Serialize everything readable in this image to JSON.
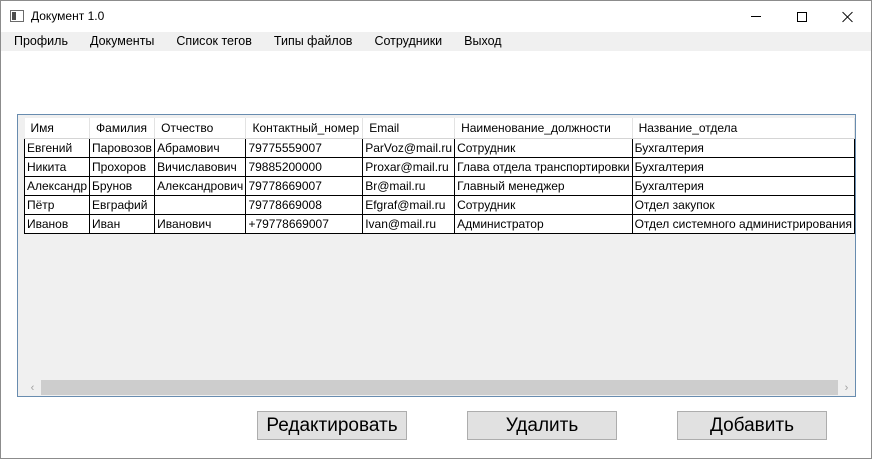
{
  "window": {
    "title": "Документ 1.0"
  },
  "menu": {
    "items": [
      "Профиль",
      "Документы",
      "Список тегов",
      "Типы файлов",
      "Сотрудники",
      "Выход"
    ]
  },
  "grid": {
    "columns": [
      "Имя",
      "Фамилия",
      "Отчество",
      "Контактный_номер",
      "Email",
      "Наименование_должности",
      "Название_отдела"
    ],
    "rows": [
      [
        "Евгений",
        "Паровозов",
        "Абрамович",
        "79775559007",
        "ParVoz@mail.ru",
        "Сотрудник",
        "Бухгалтерия"
      ],
      [
        "Никита",
        "Прохоров",
        "Вичиславович",
        "79885200000",
        "Proxar@mail.ru",
        "Глава отдела транспортировки",
        "Бухгалтерия"
      ],
      [
        "Александр",
        "Брунов",
        "Александрович",
        "79778669007",
        "Br@mail.ru",
        "Главный менеджер",
        "Бухгалтерия"
      ],
      [
        "Пётр",
        "Евграфий",
        "",
        "79778669008",
        "Efgraf@mail.ru",
        "Сотрудник",
        "Отдел закупок"
      ],
      [
        "Иванов",
        "Иван",
        "Иванович",
        "+79778669007",
        "Ivan@mail.ru",
        "Администратор",
        "Отдел системного администрирования"
      ]
    ]
  },
  "buttons": {
    "edit": "Редактировать",
    "delete": "Удалить",
    "add": "Добавить"
  },
  "scrollbar": {
    "left_arrow": "‹",
    "right_arrow": "›"
  }
}
